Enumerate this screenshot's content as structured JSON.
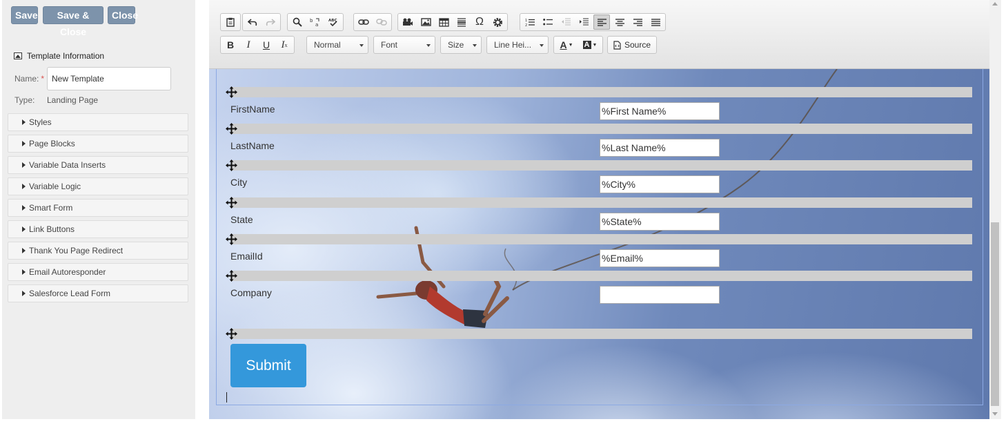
{
  "top_buttons": {
    "save": "Save",
    "save_close": "Save & Close",
    "close": "Close"
  },
  "template_info": {
    "heading": "Template Information",
    "name_label": "Name:",
    "required_mark": "*",
    "name_value": "New Template",
    "type_label": "Type:",
    "type_value": "Landing Page"
  },
  "accordion": [
    "Styles",
    "Page Blocks",
    "Variable Data Inserts",
    "Variable Logic",
    "Smart Form",
    "Link Buttons",
    "Thank You Page Redirect",
    "Email Autoresponder",
    "Salesforce Lead Form"
  ],
  "toolbar": {
    "format": "Normal",
    "font": "Font",
    "size": "Size",
    "line_height": "Line Hei...",
    "source": "Source",
    "text_color_glyph": "A",
    "bg_color_glyph": "A",
    "special_char_glyph": "Ω"
  },
  "form": {
    "fields": [
      {
        "label": "FirstName",
        "value": "%First Name%"
      },
      {
        "label": "LastName",
        "value": "%Last Name%"
      },
      {
        "label": "City",
        "value": "%City%"
      },
      {
        "label": "State",
        "value": "%State%"
      },
      {
        "label": "EmailId",
        "value": "%Email%"
      },
      {
        "label": "Company",
        "value": ""
      }
    ],
    "submit": "Submit"
  },
  "colors": {
    "accent": "#3498db",
    "button": "#7d93ab",
    "bar": "#cfcfcf"
  }
}
